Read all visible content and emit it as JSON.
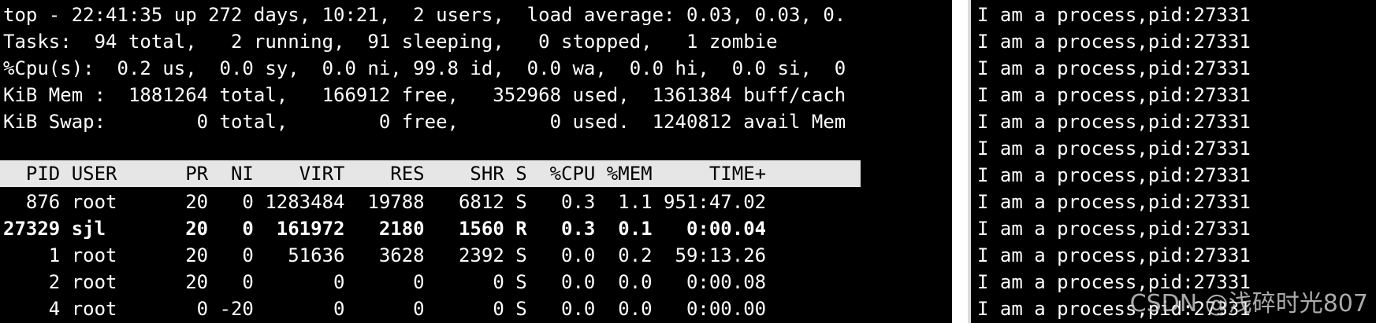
{
  "top_pane": {
    "summary": [
      "top - 22:41:35 up 272 days, 10:21,  2 users,  load average: 0.03, 0.03, 0.",
      "Tasks:  94 total,   2 running,  91 sleeping,   0 stopped,   1 zombie",
      "%Cpu(s):  0.2 us,  0.0 sy,  0.0 ni, 99.8 id,  0.0 wa,  0.0 hi,  0.0 si,  0",
      "KiB Mem :  1881264 total,   166912 free,   352968 used,  1361384 buff/cach",
      "KiB Swap:        0 total,        0 free,        0 used.  1240812 avail Mem"
    ],
    "column_header": "  PID USER      PR  NI    VIRT    RES    SHR S  %CPU %MEM     TIME+",
    "processes": [
      "  876 root      20   0 1283484  19788   6812 S   0.3  1.1 951:47.02",
      "27329 sjl       20   0  161972   2180   1560 R   0.3  0.1   0:00.04",
      "    1 root      20   0   51636   3628   2392 S   0.0  0.2  59:13.26",
      "    2 root      20   0       0      0      0 S   0.0  0.0   0:00.08",
      "    4 root       0 -20       0      0      0 S   0.0  0.0   0:00.00"
    ]
  },
  "output_pane": {
    "lines": [
      "I am a process,pid:27331",
      "I am a process,pid:27331",
      "I am a process,pid:27331",
      "I am a process,pid:27331",
      "I am a process,pid:27331",
      "I am a process,pid:27331",
      "I am a process,pid:27331",
      "I am a process,pid:27331",
      "I am a process,pid:27331",
      "I am a process,pid:27331",
      "I am a process,pid:27331",
      "I am a process,pid:27331"
    ]
  },
  "watermark": "CSDN @浅碎时光807",
  "colors": {
    "background": "#000000",
    "text": "#ffffff",
    "header_bg": "#e6e6e6",
    "header_text": "#000000"
  }
}
